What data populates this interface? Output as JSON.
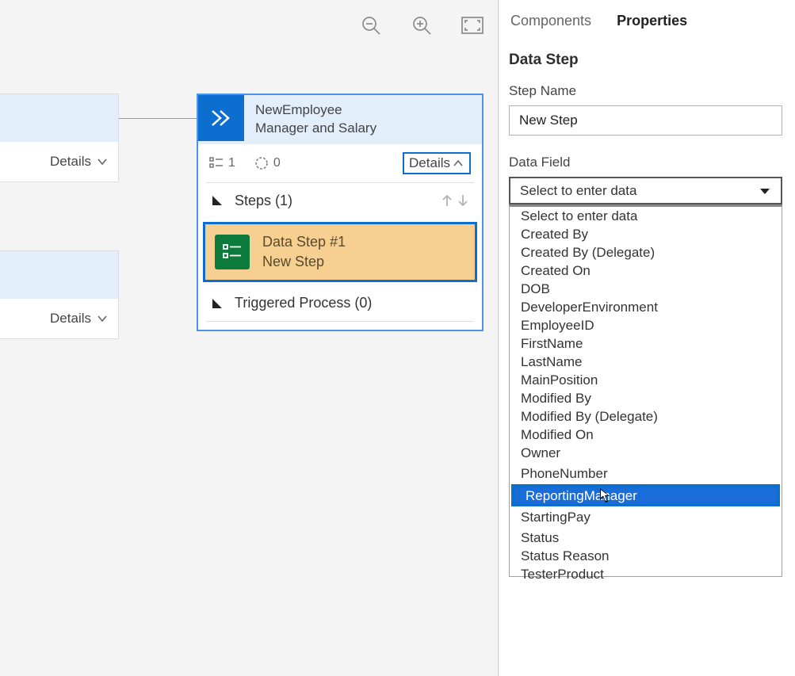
{
  "canvas": {
    "partial1_details": "Details",
    "partial2_details": "Details"
  },
  "stage": {
    "title_line1": "NewEmployee",
    "title_line2": "Manager and Salary",
    "count1": "1",
    "count2": "0",
    "details_label": "Details",
    "steps_label": "Steps (1)",
    "data_step_line1": "Data Step #1",
    "data_step_line2": "New Step",
    "triggered_label": "Triggered Process (0)"
  },
  "panel": {
    "tab_components": "Components",
    "tab_properties": "Properties",
    "heading": "Data Step",
    "step_name_label": "Step Name",
    "step_name_value": "New Step",
    "data_field_label": "Data Field",
    "select_placeholder": "Select to enter data",
    "options": [
      "Select to enter data",
      "Created By",
      "Created By (Delegate)",
      "Created On",
      "DOB",
      "DeveloperEnvironment",
      "EmployeeID",
      "FirstName",
      "LastName",
      "MainPosition",
      "Modified By",
      "Modified By (Delegate)",
      "Modified On",
      "Owner",
      "PhoneNumber",
      "ReportingManager",
      "StartingPay",
      "Status",
      "Status Reason",
      "TesterProduct"
    ],
    "selected_index": 15
  }
}
